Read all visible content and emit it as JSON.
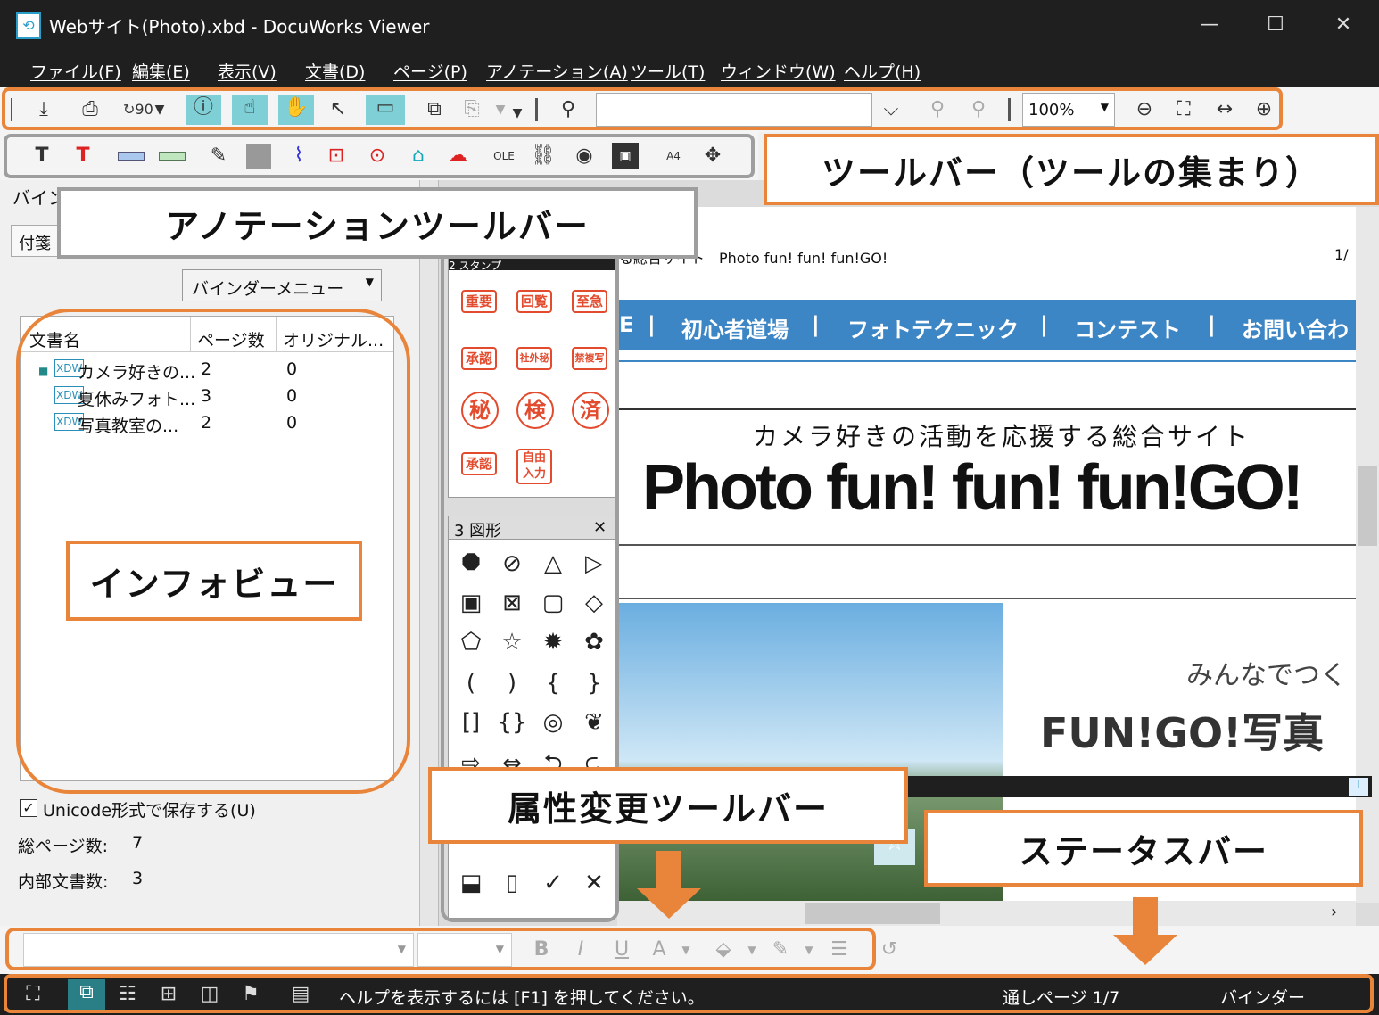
{
  "window": {
    "title": "Webサイト(Photo).xbd - DocuWorks Viewer"
  },
  "menu": [
    "ファイル(F)",
    "編集(E)",
    "表示(V)",
    "文書(D)",
    "ページ(P)",
    "アノテーション(A)",
    "ツール(T)",
    "ウィンドウ(W)",
    "ヘルプ(H)"
  ],
  "toolbar": {
    "zoom": "100%",
    "search_value": ""
  },
  "labels": {
    "toolbar": "ツールバー（ツールの集まり）",
    "annotation_toolbar": "アノテーションツールバー",
    "infoview": "インフォビュー",
    "attribute_toolbar": "属性変更ツールバー",
    "statusbar": "ステータスバー"
  },
  "left_panel": {
    "tab_partial": "バイン",
    "sub_tab_partial": "付箋",
    "binder_menu": "バインダーメニュー",
    "columns": [
      "文書名",
      "ページ数",
      "オリジナル..."
    ],
    "rows": [
      {
        "name": "カメラ好きの...",
        "pages": "2",
        "original": "0"
      },
      {
        "name": "夏休みフォト...",
        "pages": "3",
        "original": "0"
      },
      {
        "name": "写真教室の...",
        "pages": "2",
        "original": "0"
      }
    ],
    "unicode_checkbox": "Unicode形式で保存する(U)",
    "total_pages_label": "総ページ数:",
    "total_pages": "7",
    "internal_docs_label": "内部文書数:",
    "internal_docs": "3"
  },
  "stamp_panel": {
    "title_partial": "2 スタンプ",
    "stamps": [
      "重要",
      "回覧",
      "至急",
      "承認",
      "社外秘",
      "禁複写",
      "秘",
      "検",
      "済",
      "承認",
      "自由入力"
    ]
  },
  "shape_panel": {
    "title": "3 図形"
  },
  "page": {
    "header_text": "る総合サイト　Photo fun! fun! fun!GO!",
    "page_num": "1/",
    "nav": [
      "E",
      "初心者道場",
      "フォトテクニック",
      "コンテスト",
      "お問い合わせ"
    ],
    "subtitle": "カメラ好きの活動を応援する総合サイト",
    "headline": "Photo fun! fun! fun!GO!",
    "side_text1": "みんなでつく",
    "side_text2": "FUN!GO!写真"
  },
  "status": {
    "help": "ヘルプを表示するには [F1] を押してください。",
    "page": "通しページ 1/7",
    "mode": "バインダー"
  }
}
